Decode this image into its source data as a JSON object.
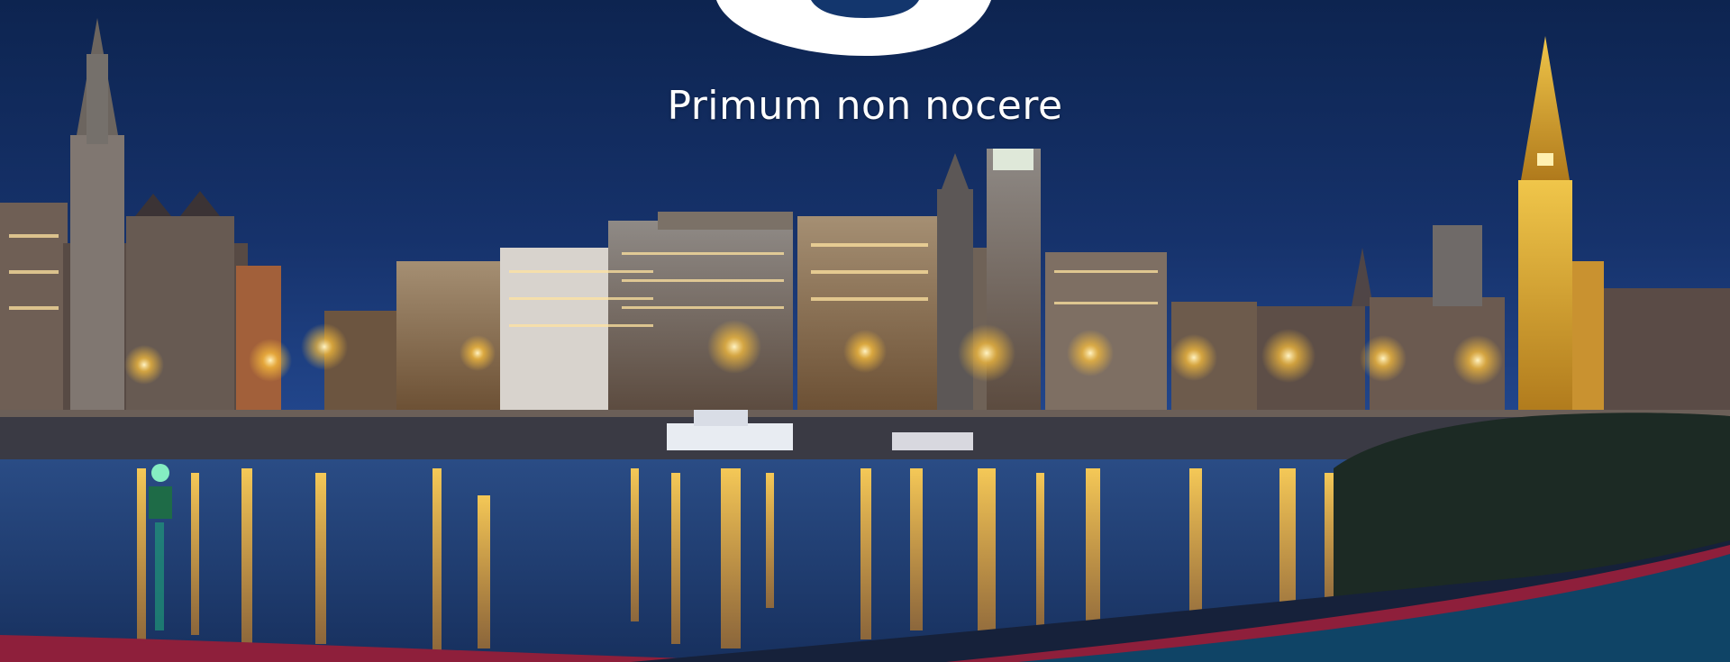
{
  "hero": {
    "motto": "Primum non nocere",
    "logo_icon": "crescent-logo-icon"
  },
  "colors": {
    "sky_top": "#0d2450",
    "sky_horizon": "#1d3f86",
    "river": "#1e3f78",
    "lights": "#ffc23a",
    "logo": "#ffffff",
    "logo_inner": "#13366d",
    "curve_teal": "#0f4466",
    "curve_red": "#8e1f3b",
    "curve_dark": "#16213a"
  }
}
